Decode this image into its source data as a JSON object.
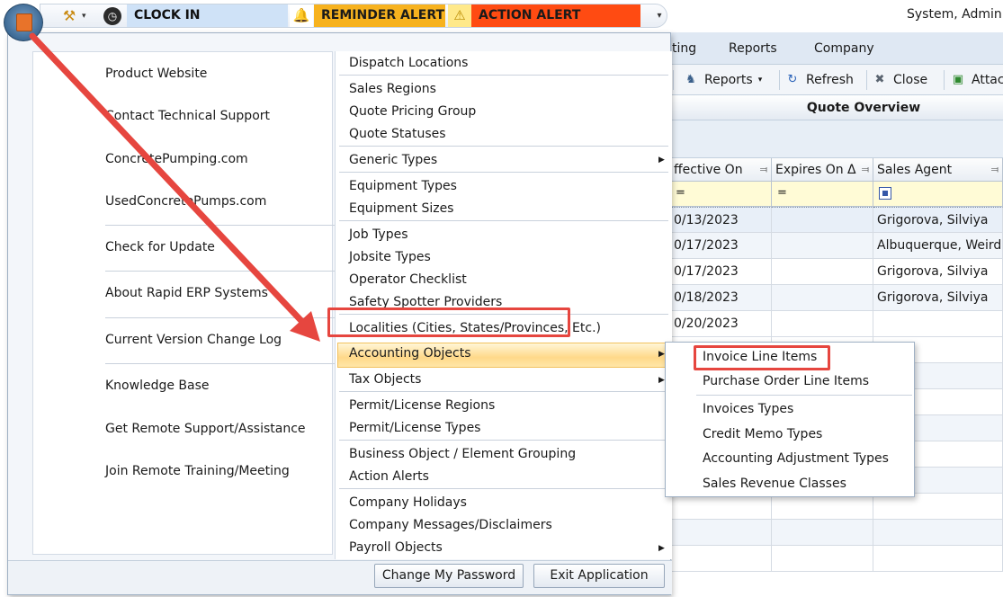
{
  "topbar": {
    "clockin_label": "CLOCK IN",
    "reminder_label": "REMINDER ALERT",
    "action_label": "ACTION ALERT",
    "user": "System, Admin |"
  },
  "ribbon": {
    "tabs": [
      "ting",
      "Reports",
      "Company"
    ],
    "buttons": {
      "reports": "Reports",
      "refresh": "Refresh",
      "close": "Close",
      "attach": "Attac"
    }
  },
  "panel": {
    "title": "Quote Overview"
  },
  "grid": {
    "columns": [
      "ffective On",
      "Expires On Δ",
      "Sales Agent"
    ],
    "filters": [
      "=",
      "="
    ],
    "rows": [
      {
        "effective": "0/13/2023",
        "expires": "",
        "agent": "Grigorova, Silviya"
      },
      {
        "effective": "0/17/2023",
        "expires": "",
        "agent": "Albuquerque, Weird"
      },
      {
        "effective": "0/17/2023",
        "expires": "",
        "agent": "Grigorova, Silviya"
      },
      {
        "effective": "0/18/2023",
        "expires": "",
        "agent": "Grigorova, Silviya"
      },
      {
        "effective": "0/20/2023",
        "expires": "",
        "agent": ""
      }
    ]
  },
  "app_menu": {
    "left_items": [
      "Product Website",
      "Contact Technical Support",
      "ConcretePumping.com",
      "UsedConcretePumps.com",
      "Check for Update",
      "About Rapid ERP Systems",
      "Current Version Change Log",
      "Knowledge Base",
      "Get Remote Support/Assistance",
      "Join Remote Training/Meeting"
    ],
    "right_items": [
      "Dispatch Locations",
      "Sales Regions",
      "Quote Pricing Group",
      "Quote Statuses",
      "Generic Types",
      "Equipment Types",
      "Equipment Sizes",
      "Job Types",
      "Jobsite Types",
      "Operator Checklist",
      "Safety Spotter Providers",
      "Localities (Cities, States/Provinces, Etc.)",
      "Accounting Objects",
      "Tax Objects",
      "Permit/License Regions",
      "Permit/License Types",
      "Business Object / Element Grouping",
      "Action Alerts",
      "Company Holidays",
      "Company Messages/Disclaimers",
      "Payroll Objects"
    ],
    "buttons": {
      "change_password": "Change My Password",
      "exit": "Exit Application"
    }
  },
  "submenu": {
    "items": [
      "Invoice Line Items",
      "Purchase Order Line Items",
      "Invoices Types",
      "Credit Memo Types",
      "Accounting Adjustment Types",
      "Sales Revenue Classes"
    ]
  },
  "colors": {
    "annotation": "#e6463f",
    "reminder": "#f7b21e",
    "action": "#ff4b12",
    "clockin": "#cfe2f7"
  }
}
